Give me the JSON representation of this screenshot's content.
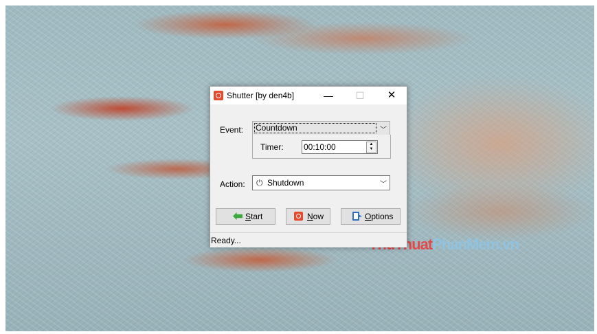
{
  "window": {
    "title": "Shutter  [by den4b]",
    "controls": {
      "minimize": "—",
      "maximize": "☐",
      "close": "✕"
    }
  },
  "event": {
    "label": "Event:",
    "selected": "Countdown",
    "timer_label": "Timer:",
    "timer_value": "00:10:00"
  },
  "action": {
    "label": "Action:",
    "selected": "Shutdown",
    "icon": "power-icon"
  },
  "buttons": {
    "start": {
      "mnemonic": "S",
      "rest": "tart",
      "icon": "start-arrow-icon"
    },
    "now": {
      "mnemonic": "N",
      "rest": "ow",
      "icon": "power-red-icon"
    },
    "options": {
      "mnemonic": "O",
      "rest": "ptions",
      "icon": "options-icon"
    }
  },
  "status": {
    "text": "Ready..."
  },
  "watermark": {
    "part1": "ThuThuat",
    "part2": "PhanMem.vn"
  },
  "colors": {
    "accent_red": "#e64a2e",
    "start_green": "#3ca93c",
    "options_blue": "#2e6fc4",
    "window_bg": "#f0f0f0"
  }
}
